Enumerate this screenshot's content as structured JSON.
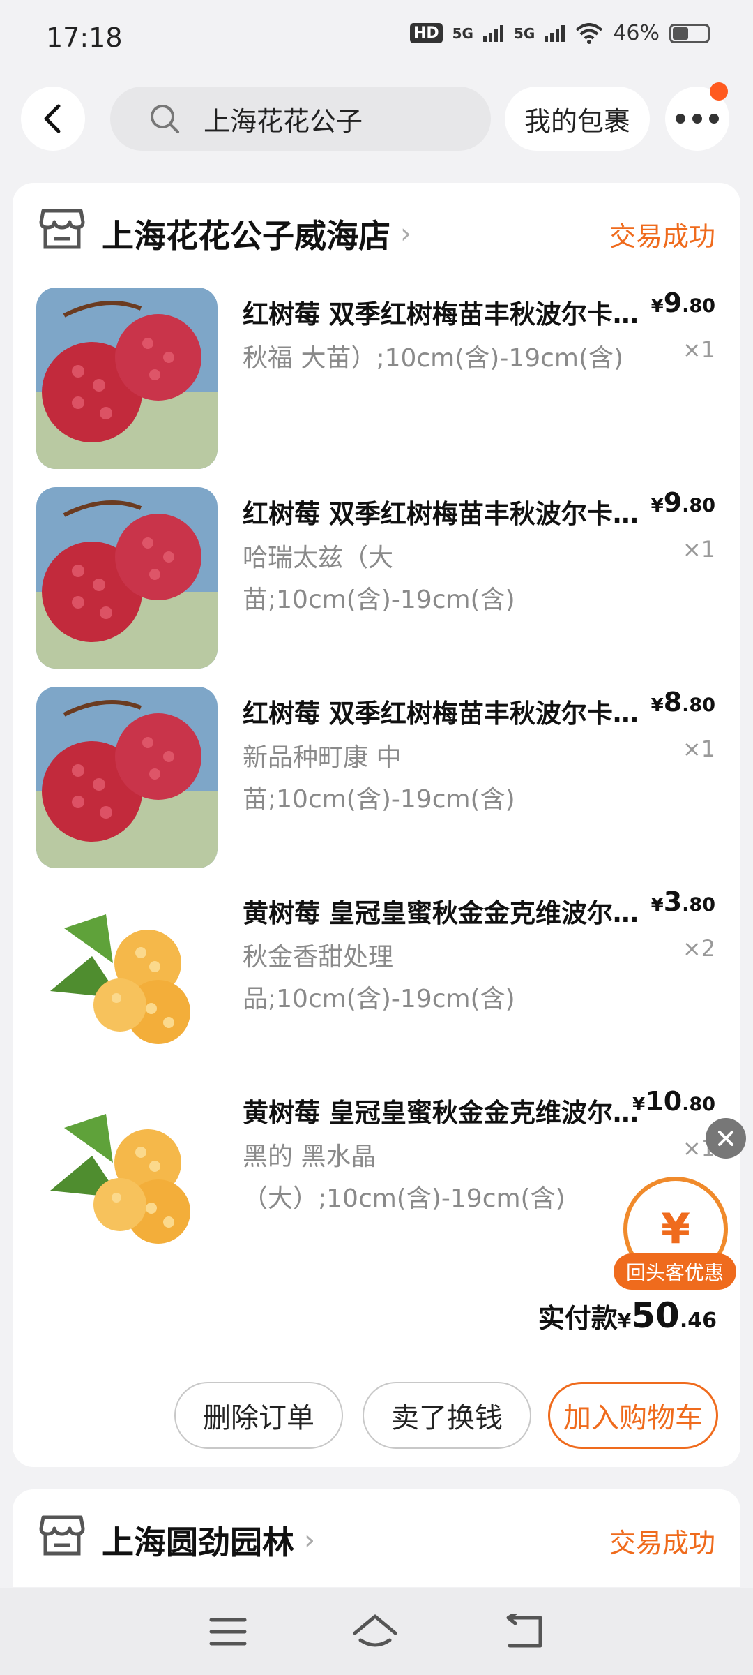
{
  "status_bar": {
    "time": "17:18",
    "network1": "HD",
    "network2": "5G",
    "network3": "5G",
    "battery": "46%",
    "battery_level": 0.46
  },
  "header": {
    "search_query": "上海花花公子",
    "package_button": "我的包裹"
  },
  "order1": {
    "shop_name": "上海花花公子威海店",
    "status": "交易成功",
    "items": [
      {
        "title": "红树莓 双季红树梅苗丰秋波尔卡黄树莓苗",
        "spec": "秋福  大苗）;10cm(含)-19cm(含)",
        "price_currency": "¥",
        "price_int": "9",
        "price_dec": ".80",
        "qty": "×1",
        "image": "red-raspberry"
      },
      {
        "title": "红树莓 双季红树梅苗丰秋波尔卡黄树莓苗",
        "spec": "哈瑞太兹（大苗;10cm(含)-19cm(含)",
        "price_currency": "¥",
        "price_int": "9",
        "price_dec": ".80",
        "qty": "×1",
        "image": "red-raspberry"
      },
      {
        "title": "红树莓 双季红树梅苗丰秋波尔卡黄树莓苗",
        "spec": "新品种町康 中苗;10cm(含)-19cm(含)",
        "price_currency": "¥",
        "price_int": "8",
        "price_dec": ".80",
        "qty": "×1",
        "image": "red-raspberry"
      },
      {
        "title": "黄树莓 皇冠皇蜜秋金金克维波尔卡树莓苗",
        "spec": "秋金香甜处理品;10cm(含)-19cm(含)",
        "price_currency": "¥",
        "price_int": "3",
        "price_dec": ".80",
        "qty": "×2",
        "image": "yellow-raspberry"
      },
      {
        "title": "黄树莓 皇冠皇蜜秋金金克维波尔卡树莓苗",
        "spec": "黑的 黑水晶（大）;10cm(含)-19cm(含)",
        "price_currency": "¥",
        "price_int": "10",
        "price_dec": ".80",
        "qty": "×1",
        "image": "yellow-raspberry"
      }
    ],
    "total_label": "实付款",
    "total_currency": "¥",
    "total_int": "50",
    "total_dec": ".46",
    "buttons": {
      "delete": "删除订单",
      "sell": "卖了换钱",
      "add_cart": "加入购物车"
    }
  },
  "coupon": {
    "symbol": "¥",
    "label": "回头客优惠"
  },
  "order2": {
    "shop_name": "上海圆劲园林",
    "status": "交易成功"
  },
  "colors": {
    "accent": "#ef6b1d",
    "background": "#f2f2f4"
  }
}
